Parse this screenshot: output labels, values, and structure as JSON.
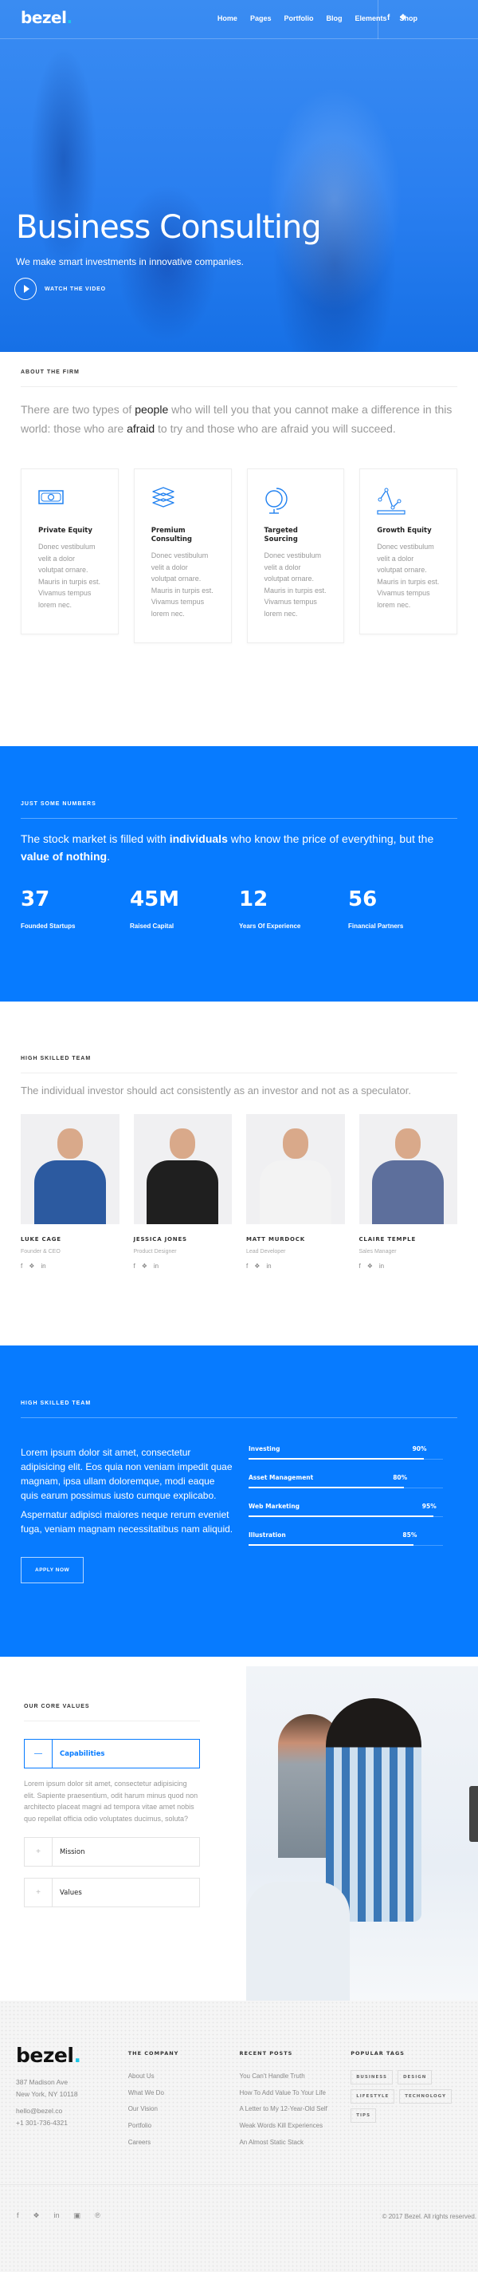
{
  "header": {
    "logo": "bezel",
    "logo_dot": ".",
    "menu": [
      "Home",
      "Pages",
      "Portfolio",
      "Blog",
      "Elements",
      "Shop"
    ],
    "social": [
      "facebook-icon",
      "twitter-icon"
    ]
  },
  "hero": {
    "title": "Business Consulting",
    "subtitle": "We make smart investments in innovative companies.",
    "watch_label": "WATCH THE VIDEO"
  },
  "about": {
    "label": "ABOUT THE FIRM",
    "lead_parts": [
      "There are two types of ",
      "people",
      " who will tell you that you cannot make a difference in this world: those who are ",
      "afraid",
      " to try and those who are afraid you will succeed."
    ],
    "cards": [
      {
        "icon": "money-bill-icon",
        "title": "Private Equity",
        "text": "Donec vestibulum velit a dolor volutpat ornare. Mauris in turpis est. Vivamus tempus lorem nec."
      },
      {
        "icon": "layers-icon",
        "title": "Premium Consulting",
        "text": "Donec vestibulum velit a dolor volutpat ornare. Mauris in turpis est. Vivamus tempus lorem nec."
      },
      {
        "icon": "globe-icon",
        "title": "Targeted Sourcing",
        "text": "Donec vestibulum velit a dolor volutpat ornare. Mauris in turpis est. Vivamus tempus lorem nec."
      },
      {
        "icon": "line-chart-icon",
        "title": "Growth Equity",
        "text": "Donec vestibulum velit a dolor volutpat ornare. Mauris in turpis est. Vivamus tempus lorem nec."
      }
    ]
  },
  "numbers": {
    "label": "JUST SOME NUMBERS",
    "lead_parts": [
      "The stock market is filled with ",
      "individuals",
      " who know the price of everything, but the ",
      "value of nothing",
      "."
    ],
    "stats": [
      {
        "value": "37",
        "label": "Founded Startups"
      },
      {
        "value": "45M",
        "label": "Raised Capital"
      },
      {
        "value": "12",
        "label": "Years Of Experience"
      },
      {
        "value": "56",
        "label": "Financial Partners"
      }
    ]
  },
  "team": {
    "label": "HIGH SKILLED TEAM",
    "lead": "The individual investor should act consistently as an investor and not as a speculator.",
    "members": [
      {
        "name": "LUKE CAGE",
        "role": "Founder & CEO",
        "shirt": "#2c5aa0"
      },
      {
        "name": "JESSICA JONES",
        "role": "Product Designer",
        "shirt": "#1f1f1f"
      },
      {
        "name": "MATT MURDOCK",
        "role": "Lead Developer",
        "shirt": "#f3f3f3"
      },
      {
        "name": "CLAIRE TEMPLE",
        "role": "Sales Manager",
        "shirt": "#5d6f9c"
      }
    ],
    "social": [
      "f",
      "❖",
      "in"
    ]
  },
  "skills": {
    "label": "HIGH SKILLED TEAM",
    "paragraphs": [
      "Lorem ipsum dolor sit amet, consectetur adipisicing elit. Eos quia non veniam impedit quae magnam, ipsa ullam doloremque, modi eaque quis earum possimus iusto cumque explicabo.",
      "Aspernatur adipisci maiores neque rerum eveniet fuga, veniam magnam necessitatibus nam aliquid."
    ],
    "apply_label": "APPLY NOW",
    "bars": [
      {
        "label": "Investing",
        "percent": 90,
        "display": "90%"
      },
      {
        "label": "Asset Management",
        "percent": 80,
        "display": "80%"
      },
      {
        "label": "Web Marketing",
        "percent": 95,
        "display": "95%"
      },
      {
        "label": "Illustration",
        "percent": 85,
        "display": "85%"
      }
    ]
  },
  "values": {
    "label": "OUR CORE VALUES",
    "accordion": [
      {
        "title": "Capabilities",
        "sign": "—",
        "open": true,
        "body": "Lorem ipsum dolor sit amet, consectetur adipisicing elit. Sapiente praesentium, odit harum minus quod non architecto placeat magni ad tempora vitae amet nobis quo repellat officia odio voluptates ducimus, soluta?"
      },
      {
        "title": "Mission",
        "sign": "+",
        "open": false
      },
      {
        "title": "Values",
        "sign": "+",
        "open": false
      }
    ]
  },
  "footer": {
    "logo": "bezel",
    "logo_dot": ".",
    "address": [
      "387 Madison Ave",
      "New York, NY 10118"
    ],
    "contact": [
      "hello@bezel.co",
      "+1 301-736-4321"
    ],
    "company": {
      "title": "THE COMPANY",
      "links": [
        "About Us",
        "What We Do",
        "Our Vision",
        "Portfolio",
        "Careers"
      ]
    },
    "posts": {
      "title": "RECENT POSTS",
      "links": [
        "You Can't Handle Truth",
        "How To Add Value To Your Life",
        "A Letter to My 12-Year-Old Self",
        "Weak Words Kill Experiences",
        "An Almost Static Stack"
      ]
    },
    "tags": {
      "title": "POPULAR TAGS",
      "items": [
        "BUSINESS",
        "DESIGN",
        "LIFESTYLE",
        "TECHNOLOGY",
        "TIPS"
      ]
    },
    "social": [
      {
        "name": "facebook-icon",
        "glyph": "f"
      },
      {
        "name": "twitter-icon",
        "glyph": "❖"
      },
      {
        "name": "linkedin-icon",
        "glyph": "in"
      },
      {
        "name": "instagram-icon",
        "glyph": "▣"
      },
      {
        "name": "pinterest-icon",
        "glyph": "℗"
      }
    ],
    "copyright": "© 2017 Bezel. All rights reserved."
  },
  "colors": {
    "accent": "#077bff",
    "logo_dot": "#1cc7e8"
  }
}
